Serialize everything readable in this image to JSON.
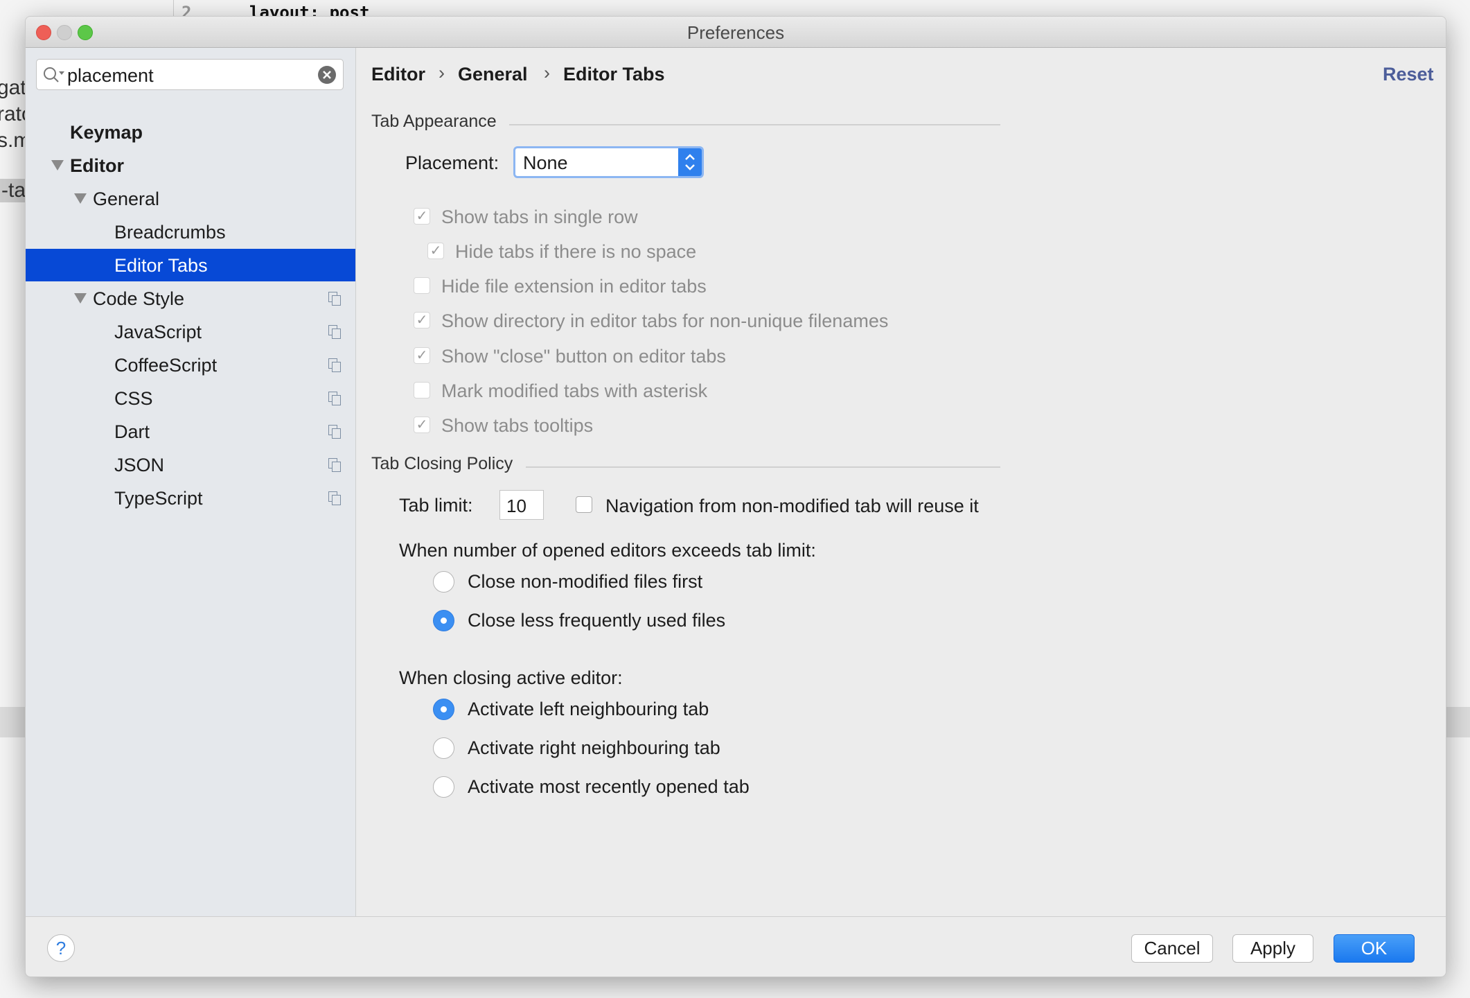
{
  "background": {
    "line_number": "2",
    "code_line": "layout: post",
    "left_fragments": [
      "gate",
      "rato",
      "s.m",
      "-ta"
    ]
  },
  "window": {
    "title": "Preferences"
  },
  "search": {
    "value": "placement"
  },
  "tree": [
    {
      "label": "Keymap",
      "bold": true
    },
    {
      "label": "Editor",
      "bold": true,
      "expanded": true
    },
    {
      "label": "General",
      "expanded": true
    },
    {
      "label": "Breadcrumbs"
    },
    {
      "label": "Editor Tabs",
      "selected": true
    },
    {
      "label": "Code Style",
      "expanded": true,
      "copy_icon": true
    },
    {
      "label": "JavaScript",
      "copy_icon": true
    },
    {
      "label": "CoffeeScript",
      "copy_icon": true
    },
    {
      "label": "CSS",
      "copy_icon": true
    },
    {
      "label": "Dart",
      "copy_icon": true
    },
    {
      "label": "JSON",
      "copy_icon": true
    },
    {
      "label": "TypeScript",
      "copy_icon": true
    }
  ],
  "breadcrumb": [
    "Editor",
    "General",
    "Editor Tabs"
  ],
  "reset_label": "Reset",
  "tab_appearance": {
    "title": "Tab Appearance",
    "placement_label": "Placement:",
    "placement_value": "None",
    "checkboxes": [
      {
        "label": "Show tabs in single row",
        "checked": true
      },
      {
        "label": "Hide tabs if there is no space",
        "checked": true
      },
      {
        "label": "Hide file extension in editor tabs",
        "checked": false
      },
      {
        "label": "Show directory in editor tabs for non-unique filenames",
        "checked": true
      },
      {
        "label": "Show \"close\" button on editor tabs",
        "checked": true
      },
      {
        "label": "Mark modified tabs with asterisk",
        "checked": false
      },
      {
        "label": "Show tabs tooltips",
        "checked": true
      }
    ]
  },
  "tab_closing": {
    "title": "Tab Closing Policy",
    "tab_limit_label": "Tab limit:",
    "tab_limit_value": "10",
    "reuse_label": "Navigation from non-modified tab will reuse it",
    "reuse_checked": false,
    "exceeds_label": "When number of opened editors exceeds tab limit:",
    "exceeds_options": [
      {
        "label": "Close non-modified files first",
        "selected": false
      },
      {
        "label": "Close less frequently used files",
        "selected": true
      }
    ],
    "closing_label": "When closing active editor:",
    "closing_options": [
      {
        "label": "Activate left neighbouring tab",
        "selected": true
      },
      {
        "label": "Activate right neighbouring tab",
        "selected": false
      },
      {
        "label": "Activate most recently opened tab",
        "selected": false
      }
    ]
  },
  "footer": {
    "help": "?",
    "cancel": "Cancel",
    "apply": "Apply",
    "ok": "OK"
  },
  "colors": {
    "selection": "#0749d6",
    "accent": "#3b8ff2",
    "reset": "#4d5e9a"
  }
}
